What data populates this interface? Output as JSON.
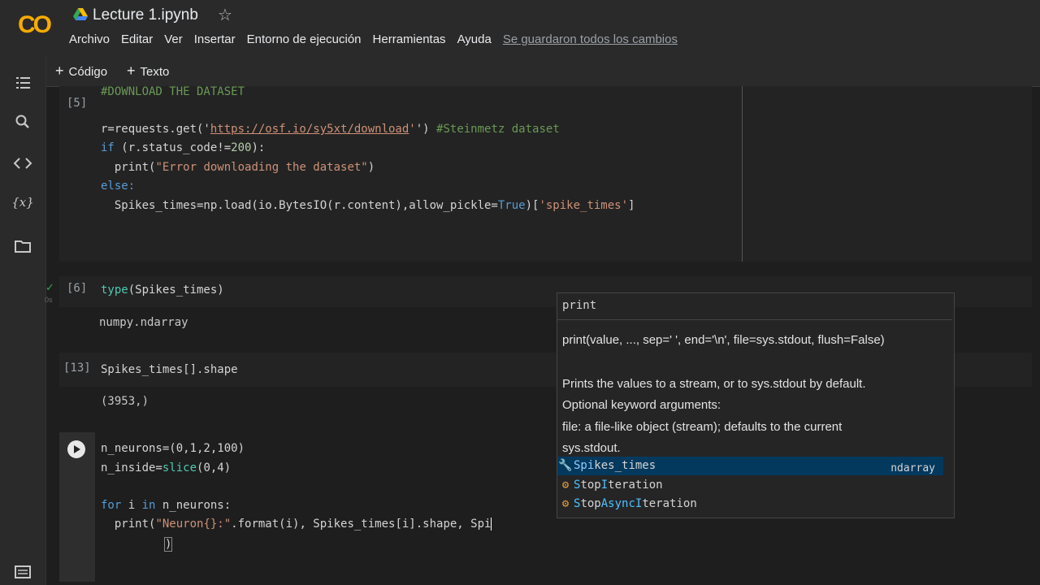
{
  "app": {
    "logo": "CO",
    "notebook_title": "Lecture 1.ipynb",
    "menu": [
      "Archivo",
      "Editar",
      "Ver",
      "Insertar",
      "Entorno de ejecución",
      "Herramientas",
      "Ayuda"
    ],
    "saved_status": "Se guardaron todos los cambios"
  },
  "toolbar": {
    "add_code": "Código",
    "add_text": "Texto"
  },
  "sidebar": {
    "icons": [
      "toc-icon",
      "search-icon",
      "code-snippets-icon",
      "variables-icon",
      "files-icon",
      "terminal-icon"
    ]
  },
  "cells": {
    "c5": {
      "exec": "[5]",
      "line1": "#DOWNLOAD THE DATASET",
      "line2a": "r=requests.get('",
      "line2url": "https://osf.io/sy5xt/download",
      "line2b": "') ",
      "line2c": "#Steinmetz dataset",
      "line3a": "if",
      "line3b": " (r.status_code!=",
      "line3c": "200",
      "line3d": "):",
      "line4a": "  print(",
      "line4b": "\"Error downloading the dataset\"",
      "line4c": ")",
      "line5": "else:",
      "line6a": "  Spikes_times=np.load(io.BytesIO(r.content),allow_pickle=",
      "line6b": "True",
      "line6c": ")[",
      "line6d": "'spike_times'",
      "line6e": "]"
    },
    "c6": {
      "exec": "[6]",
      "check": "✓",
      "time": "0s",
      "code_a": "type",
      "code_b": "(Spikes_times)",
      "output": "numpy.ndarray"
    },
    "c13": {
      "exec": "[13]",
      "code": "Spikes_times[].shape",
      "output": "(3953,)"
    },
    "active": {
      "l1": "n_neurons=(0,1,2,100)",
      "l2a": "n_inside=",
      "l2b": "slice",
      "l2c": "(0,4)",
      "l3a": "for",
      "l3b": " i ",
      "l3c": "in",
      "l3d": " n_neurons:",
      "l4a": "  print(",
      "l4b": "\"Neuron{}:\"",
      "l4c": ".format(i), Spikes_times[i].shape, Spi",
      "l5": ")"
    }
  },
  "tooltip": {
    "header": "print",
    "signature": "print(value, ..., sep=' ', end='\\n', file=sys.stdout, flush=False)",
    "doc1": "Prints the values to a stream, or to sys.stdout by default.",
    "doc2": "Optional keyword arguments:",
    "doc3": "file:  a file-like object (stream); defaults to the current",
    "doc4": "sys.stdout.",
    "suggestions": [
      {
        "prefix": "Spi",
        "rest": "kes_times",
        "type": "ndarray"
      },
      {
        "prefix": "S",
        "mid1": "top",
        "mid2": "I",
        "rest": "teration"
      },
      {
        "prefix": "S",
        "mid1": "top",
        "mid2": "AsyncI",
        "rest": "teration"
      }
    ]
  },
  "colors": {
    "background": "#1e1e1e",
    "logo": "#f9ab00",
    "keyword": "#569cd6",
    "string": "#ce9178",
    "comment": "#6a9955",
    "selection": "#04395e"
  }
}
